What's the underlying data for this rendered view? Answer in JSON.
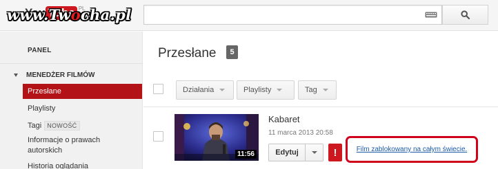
{
  "header": {
    "logo_you": "You",
    "logo_tube": "Tube",
    "logo_country": "PL",
    "watermark_left": "www.Tw",
    "watermark_o": "o",
    "watermark_right": "cha.pl",
    "search": {
      "value": "",
      "placeholder": ""
    }
  },
  "sidebar": {
    "panel": "PANEL",
    "manager": "MENEDŻER FILMÓW",
    "items": [
      {
        "label": "Przesłane"
      },
      {
        "label": "Playlisty"
      },
      {
        "label": "Tagi",
        "badge": "NOWOŚĆ"
      },
      {
        "label": "Informacje o prawach"
      },
      {
        "label": "autorskich"
      },
      {
        "label": "Historia oglądania"
      }
    ]
  },
  "main": {
    "title": "Przesłane",
    "count": "5",
    "toolbar": {
      "actions": "Działania",
      "playlists": "Playlisty",
      "tag": "Tag"
    },
    "video": {
      "title": "Kabaret",
      "date": "11 marca 2013 20:58",
      "duration": "11:56",
      "edit_label": "Edytuj",
      "warning_icon": "!",
      "blocked_text": "Film zablokowany na całym świecie."
    }
  },
  "colors": {
    "accent": "#b31217",
    "warning": "#cc181e",
    "highlight": "#d0021b",
    "link": "#1a5aa8"
  }
}
